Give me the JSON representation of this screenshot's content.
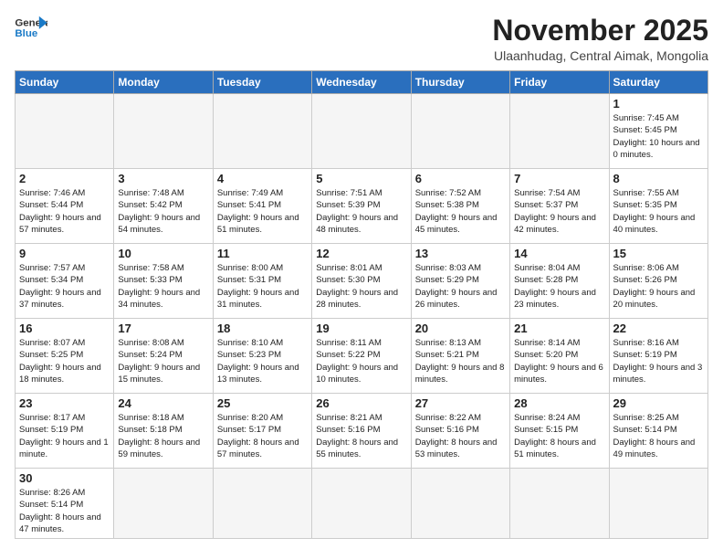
{
  "logo": {
    "line1": "General",
    "line2": "Blue"
  },
  "title": "November 2025",
  "subtitle": "Ulaanhudag, Central Aimak, Mongolia",
  "weekdays": [
    "Sunday",
    "Monday",
    "Tuesday",
    "Wednesday",
    "Thursday",
    "Friday",
    "Saturday"
  ],
  "weeks": [
    [
      {
        "day": "",
        "info": ""
      },
      {
        "day": "",
        "info": ""
      },
      {
        "day": "",
        "info": ""
      },
      {
        "day": "",
        "info": ""
      },
      {
        "day": "",
        "info": ""
      },
      {
        "day": "",
        "info": ""
      },
      {
        "day": "1",
        "info": "Sunrise: 7:45 AM\nSunset: 5:45 PM\nDaylight: 10 hours\nand 0 minutes."
      }
    ],
    [
      {
        "day": "2",
        "info": "Sunrise: 7:46 AM\nSunset: 5:44 PM\nDaylight: 9 hours\nand 57 minutes."
      },
      {
        "day": "3",
        "info": "Sunrise: 7:48 AM\nSunset: 5:42 PM\nDaylight: 9 hours\nand 54 minutes."
      },
      {
        "day": "4",
        "info": "Sunrise: 7:49 AM\nSunset: 5:41 PM\nDaylight: 9 hours\nand 51 minutes."
      },
      {
        "day": "5",
        "info": "Sunrise: 7:51 AM\nSunset: 5:39 PM\nDaylight: 9 hours\nand 48 minutes."
      },
      {
        "day": "6",
        "info": "Sunrise: 7:52 AM\nSunset: 5:38 PM\nDaylight: 9 hours\nand 45 minutes."
      },
      {
        "day": "7",
        "info": "Sunrise: 7:54 AM\nSunset: 5:37 PM\nDaylight: 9 hours\nand 42 minutes."
      },
      {
        "day": "8",
        "info": "Sunrise: 7:55 AM\nSunset: 5:35 PM\nDaylight: 9 hours\nand 40 minutes."
      }
    ],
    [
      {
        "day": "9",
        "info": "Sunrise: 7:57 AM\nSunset: 5:34 PM\nDaylight: 9 hours\nand 37 minutes."
      },
      {
        "day": "10",
        "info": "Sunrise: 7:58 AM\nSunset: 5:33 PM\nDaylight: 9 hours\nand 34 minutes."
      },
      {
        "day": "11",
        "info": "Sunrise: 8:00 AM\nSunset: 5:31 PM\nDaylight: 9 hours\nand 31 minutes."
      },
      {
        "day": "12",
        "info": "Sunrise: 8:01 AM\nSunset: 5:30 PM\nDaylight: 9 hours\nand 28 minutes."
      },
      {
        "day": "13",
        "info": "Sunrise: 8:03 AM\nSunset: 5:29 PM\nDaylight: 9 hours\nand 26 minutes."
      },
      {
        "day": "14",
        "info": "Sunrise: 8:04 AM\nSunset: 5:28 PM\nDaylight: 9 hours\nand 23 minutes."
      },
      {
        "day": "15",
        "info": "Sunrise: 8:06 AM\nSunset: 5:26 PM\nDaylight: 9 hours\nand 20 minutes."
      }
    ],
    [
      {
        "day": "16",
        "info": "Sunrise: 8:07 AM\nSunset: 5:25 PM\nDaylight: 9 hours\nand 18 minutes."
      },
      {
        "day": "17",
        "info": "Sunrise: 8:08 AM\nSunset: 5:24 PM\nDaylight: 9 hours\nand 15 minutes."
      },
      {
        "day": "18",
        "info": "Sunrise: 8:10 AM\nSunset: 5:23 PM\nDaylight: 9 hours\nand 13 minutes."
      },
      {
        "day": "19",
        "info": "Sunrise: 8:11 AM\nSunset: 5:22 PM\nDaylight: 9 hours\nand 10 minutes."
      },
      {
        "day": "20",
        "info": "Sunrise: 8:13 AM\nSunset: 5:21 PM\nDaylight: 9 hours\nand 8 minutes."
      },
      {
        "day": "21",
        "info": "Sunrise: 8:14 AM\nSunset: 5:20 PM\nDaylight: 9 hours\nand 6 minutes."
      },
      {
        "day": "22",
        "info": "Sunrise: 8:16 AM\nSunset: 5:19 PM\nDaylight: 9 hours\nand 3 minutes."
      }
    ],
    [
      {
        "day": "23",
        "info": "Sunrise: 8:17 AM\nSunset: 5:19 PM\nDaylight: 9 hours\nand 1 minute."
      },
      {
        "day": "24",
        "info": "Sunrise: 8:18 AM\nSunset: 5:18 PM\nDaylight: 8 hours\nand 59 minutes."
      },
      {
        "day": "25",
        "info": "Sunrise: 8:20 AM\nSunset: 5:17 PM\nDaylight: 8 hours\nand 57 minutes."
      },
      {
        "day": "26",
        "info": "Sunrise: 8:21 AM\nSunset: 5:16 PM\nDaylight: 8 hours\nand 55 minutes."
      },
      {
        "day": "27",
        "info": "Sunrise: 8:22 AM\nSunset: 5:16 PM\nDaylight: 8 hours\nand 53 minutes."
      },
      {
        "day": "28",
        "info": "Sunrise: 8:24 AM\nSunset: 5:15 PM\nDaylight: 8 hours\nand 51 minutes."
      },
      {
        "day": "29",
        "info": "Sunrise: 8:25 AM\nSunset: 5:14 PM\nDaylight: 8 hours\nand 49 minutes."
      }
    ],
    [
      {
        "day": "30",
        "info": "Sunrise: 8:26 AM\nSunset: 5:14 PM\nDaylight: 8 hours\nand 47 minutes."
      },
      {
        "day": "",
        "info": ""
      },
      {
        "day": "",
        "info": ""
      },
      {
        "day": "",
        "info": ""
      },
      {
        "day": "",
        "info": ""
      },
      {
        "day": "",
        "info": ""
      },
      {
        "day": "",
        "info": ""
      }
    ]
  ]
}
